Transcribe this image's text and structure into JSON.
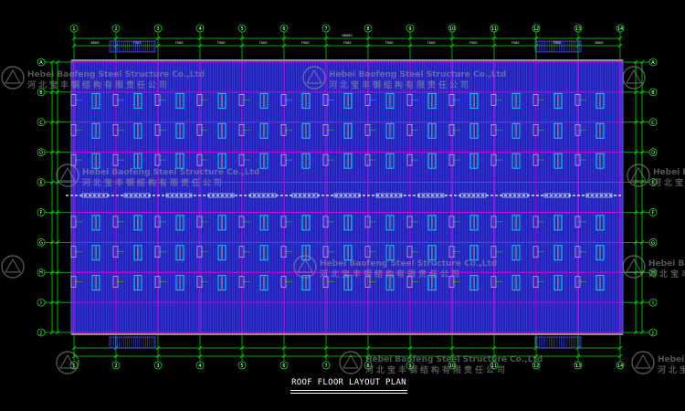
{
  "drawing": {
    "title": "ROOF FLOOR LAYOUT PLAN",
    "watermark_en": "Hebei Baofeng Steel Structure Co.,Ltd",
    "watermark_cn": "河北宝丰钢结构有限责任公司",
    "overall_dimension": "96000",
    "column_axis_labels": [
      "1",
      "2",
      "3",
      "4",
      "5",
      "6",
      "7",
      "8",
      "9",
      "10",
      "11",
      "12",
      "13",
      "14"
    ],
    "row_axis_labels": [
      "A",
      "B",
      "C",
      "D",
      "E",
      "F",
      "G",
      "H",
      "I",
      "J"
    ],
    "bay_dimension": "7500",
    "end_bay_dimension": "6000"
  },
  "colors": {
    "background": "#000000",
    "roof_fill": "#1f1fb4",
    "purlin_line": "#5a5aff",
    "grid_line": "#e600e6",
    "dimension_line": "#00e000",
    "ridge_line": "#ffffff",
    "eave_line": "#ffff00",
    "skylight": "#00ffff",
    "watermark": "#9a9a9a",
    "title": "#ffffff"
  }
}
